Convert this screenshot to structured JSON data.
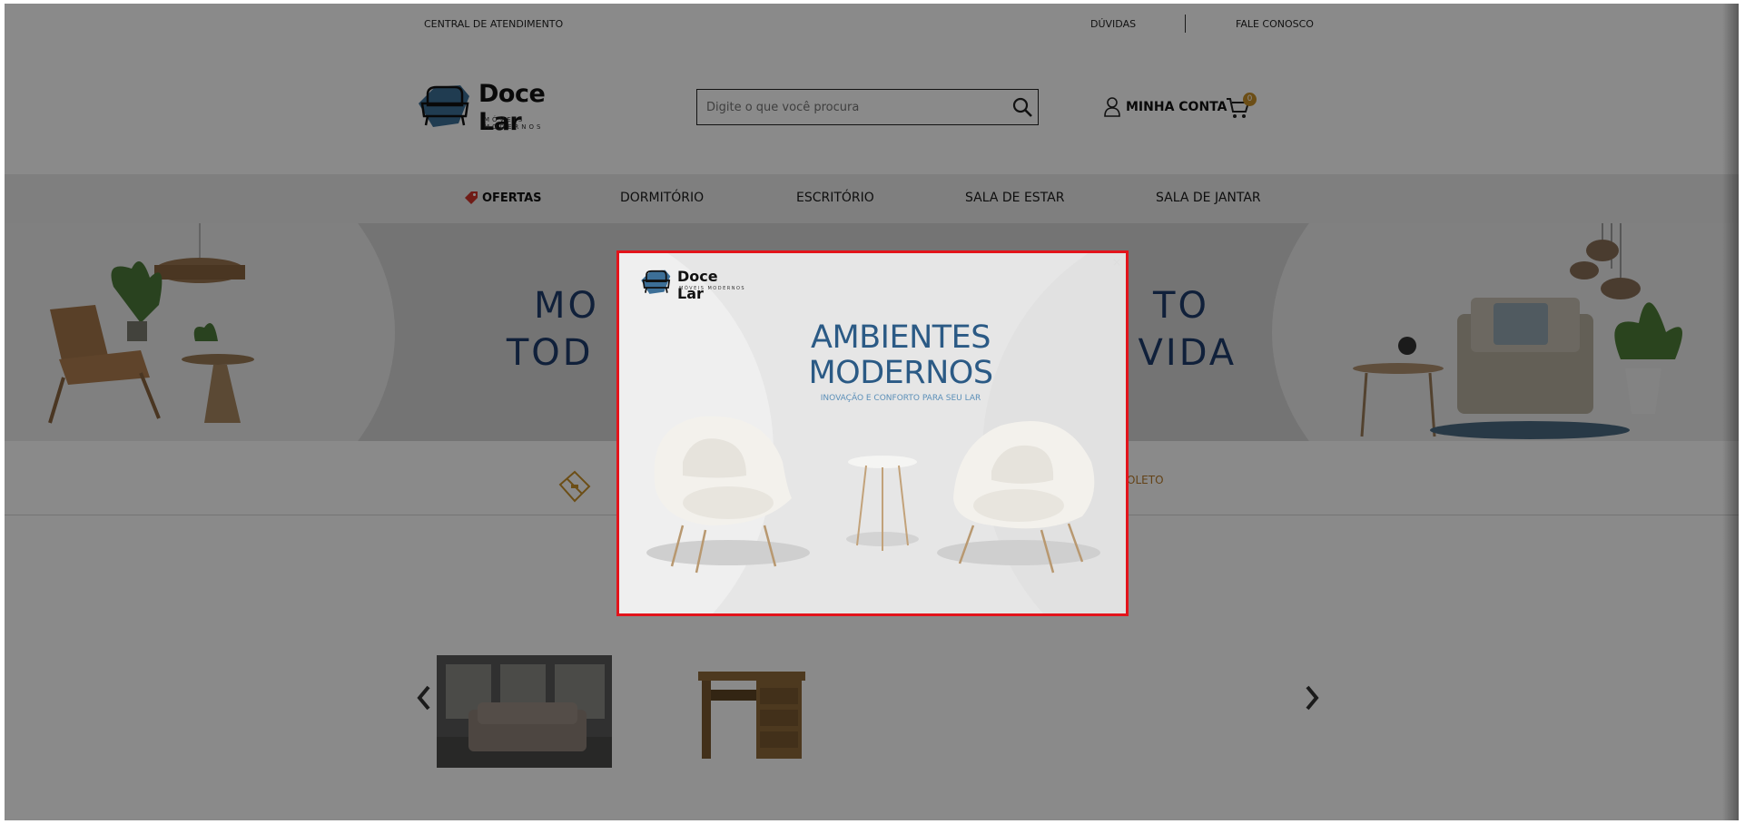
{
  "topbar": {
    "service_center": "CENTRAL DE ATENDIMENTO",
    "faq": "DÚVIDAS",
    "contact": "FALE CONOSCO"
  },
  "header": {
    "brand": "Doce Lar",
    "tagline": "MÓVEIS MODERNOS",
    "search_placeholder": "Digite o que você procura",
    "account_label": "MINHA CONTA",
    "cart_count": "0"
  },
  "nav": {
    "items": [
      {
        "label": "OFERTAS",
        "icon": "tag-icon",
        "color": "#d0342c"
      },
      {
        "label": "DORMITÓRIO"
      },
      {
        "label": "ESCRITÓRIO"
      },
      {
        "label": "SALA DE ESTAR"
      },
      {
        "label": "SALA DE JANTAR"
      }
    ]
  },
  "hero": {
    "line1_left": "MO",
    "line1_right": "TO",
    "line2_left": "TOD",
    "line2_right": "VIDA"
  },
  "features": {
    "boleto": "BOLETO"
  },
  "modal": {
    "brand": "Doce Lar",
    "tagline": "MÓVEIS MODERNOS",
    "title_line1": "AMBIENTES",
    "title_line2": "MODERNOS",
    "subtitle": "INOVAÇÃO E CONFORTO PARA SEU LAR",
    "border_color": "#e3141b",
    "close": "×"
  },
  "colors": {
    "accent_gold": "#c8912a",
    "hero_blue": "#1f3c6b",
    "modal_blue": "#2b5a85"
  }
}
